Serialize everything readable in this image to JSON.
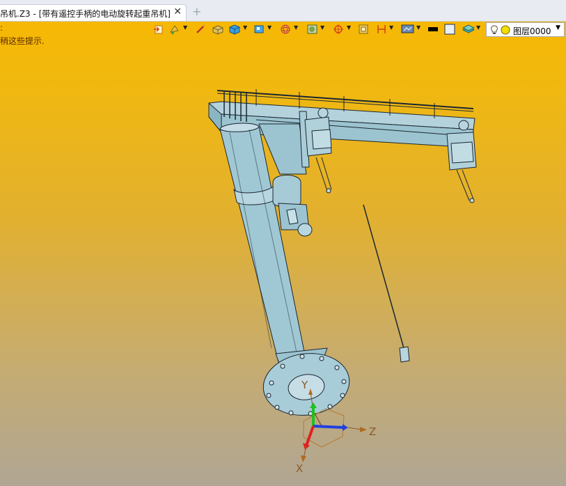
{
  "tab": {
    "title": "吊机.Z3 - [带有遥控手柄的电动旋转起重吊机]",
    "close_glyph": "✕",
    "add_glyph": "+"
  },
  "hint": {
    "top_glyph": ":",
    "text": "稍这些提示."
  },
  "toolbar": {
    "icons": [
      "import-icon",
      "paint-icon",
      "pen-icon",
      "block-icon",
      "cube-icon",
      "view-cube-icon",
      "wireframe-sphere-icon",
      "render-style-icon",
      "crosshair-icon",
      "frame-icon",
      "dimension-icon",
      "display-mode-icon",
      "color-black-icon",
      "color-white-icon",
      "layer-stack-icon"
    ],
    "layer": {
      "label": "图层0000",
      "caret": "▼"
    }
  },
  "axes": {
    "x": "X",
    "y": "Y",
    "z": "Z"
  },
  "colors": {
    "background_top": "#f8b800",
    "background_bottom": "#b0a694",
    "model": "#a8ccd8",
    "model_edge": "#1a2630"
  }
}
